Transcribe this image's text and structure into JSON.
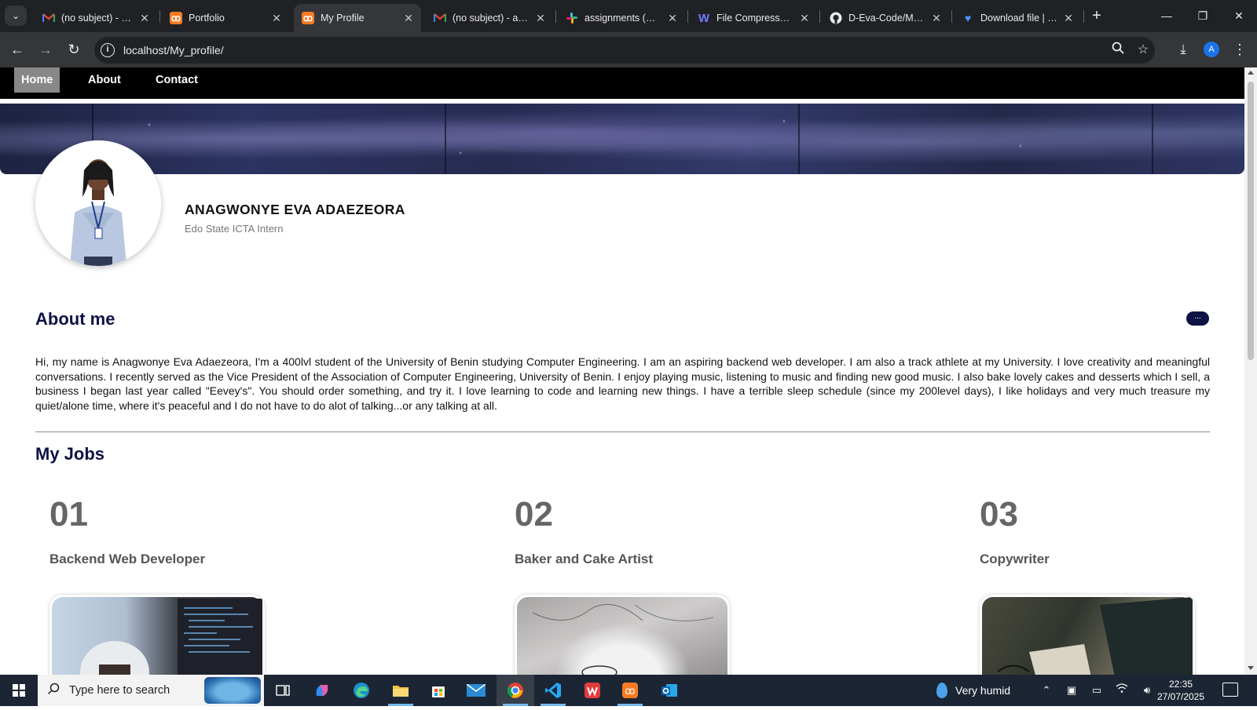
{
  "browser": {
    "tabs": [
      {
        "title": "(no subject) - anag",
        "icon": "gmail-icon"
      },
      {
        "title": "Portfolio",
        "icon": "xampp-icon"
      },
      {
        "title": "My Profile",
        "icon": "xampp-icon",
        "active": true
      },
      {
        "title": "(no subject) - anag",
        "icon": "gmail-icon"
      },
      {
        "title": "assignments (Char",
        "icon": "slack-icon"
      },
      {
        "title": "File Compressor -",
        "icon": "w-icon"
      },
      {
        "title": "D-Eva-Code/My_p",
        "icon": "github-icon"
      },
      {
        "title": "Download file | iLo",
        "icon": "heart-icon"
      }
    ],
    "url": "localhost/My_profile/",
    "profile_initial": "A"
  },
  "site": {
    "nav": [
      "Home",
      "About",
      "Contact"
    ],
    "name": "ANAGWONYE EVA ADAEZEORA",
    "role": "Edo State ICTA Intern",
    "about": {
      "title": "About me",
      "button": "...",
      "text": "Hi, my name is Anagwonye Eva Adaezeora, I'm a 400lvl student of the University of Benin studying Computer Engineering. I am an aspiring backend web developer. I am also a track athlete at my University. I love creativity and meaningful conversations. I recently served as the Vice President of the Association of Computer Engineering, University of Benin. I enjoy playing music, listening to music and finding new good music. I also bake lovely cakes and desserts which I sell, a business I began last year called \"Eevey's\". You should order something, and try it. I love learning to code and learning new things. I have a terrible sleep schedule (since my 200level days), I like holidays and very much treasure my quiet/alone time, where it's peaceful and I do not have to do alot of talking...or any talking at all."
    },
    "jobs": {
      "title": "My Jobs",
      "items": [
        {
          "num": "01",
          "title": "Backend Web Developer"
        },
        {
          "num": "02",
          "title": "Baker and Cake Artist"
        },
        {
          "num": "03",
          "title": "Copywriter"
        }
      ]
    }
  },
  "taskbar": {
    "search_placeholder": "Type here to search",
    "weather": "Very humid",
    "time": "22:35",
    "date": "27/07/2025"
  },
  "colors": {
    "heading": "#0e1245",
    "nav_bg": "#000000",
    "nav_active": "#888888",
    "chrome_dark": "#202124",
    "chrome_toolbar": "#35363a",
    "taskbar": "#1c2533"
  }
}
